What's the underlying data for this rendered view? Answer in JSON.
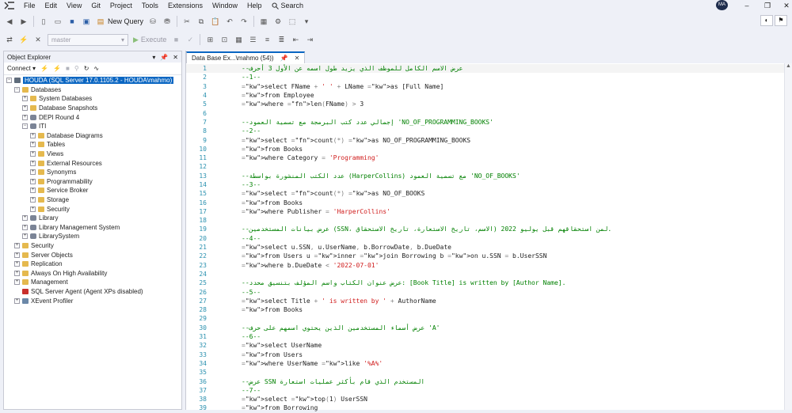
{
  "menubar": {
    "items": [
      "File",
      "Edit",
      "View",
      "Git",
      "Project",
      "Tools",
      "Extensions",
      "Window",
      "Help"
    ],
    "search_label": "Search",
    "avatar_initials": "MA"
  },
  "toolbar": {
    "new_query_label": "New Query",
    "database": "master",
    "execute_label": "Execute"
  },
  "object_explorer": {
    "title": "Object Explorer",
    "connect_label": "Connect",
    "tree": [
      {
        "label": "HOUDA (SQL Server 17.0.1105.2 - HOUDA\\mahmo)",
        "level": 0,
        "expander": "-",
        "icon": "server",
        "selected": true
      },
      {
        "label": "Databases",
        "level": 1,
        "expander": "-",
        "icon": "folder"
      },
      {
        "label": "System Databases",
        "level": 2,
        "expander": "+",
        "icon": "folder"
      },
      {
        "label": "Database Snapshots",
        "level": 2,
        "expander": "+",
        "icon": "folder"
      },
      {
        "label": "DEPI Round 4",
        "level": 2,
        "expander": "+",
        "icon": "db"
      },
      {
        "label": "ITI",
        "level": 2,
        "expander": "-",
        "icon": "db"
      },
      {
        "label": "Database Diagrams",
        "level": 3,
        "expander": "+",
        "icon": "folder"
      },
      {
        "label": "Tables",
        "level": 3,
        "expander": "+",
        "icon": "folder"
      },
      {
        "label": "Views",
        "level": 3,
        "expander": "+",
        "icon": "folder"
      },
      {
        "label": "External Resources",
        "level": 3,
        "expander": "+",
        "icon": "folder"
      },
      {
        "label": "Synonyms",
        "level": 3,
        "expander": "+",
        "icon": "folder"
      },
      {
        "label": "Programmability",
        "level": 3,
        "expander": "+",
        "icon": "folder"
      },
      {
        "label": "Service Broker",
        "level": 3,
        "expander": "+",
        "icon": "folder"
      },
      {
        "label": "Storage",
        "level": 3,
        "expander": "+",
        "icon": "folder"
      },
      {
        "label": "Security",
        "level": 3,
        "expander": "+",
        "icon": "folder"
      },
      {
        "label": "Library",
        "level": 2,
        "expander": "+",
        "icon": "db"
      },
      {
        "label": "Library Management System",
        "level": 2,
        "expander": "+",
        "icon": "db"
      },
      {
        "label": "LibrarySystem",
        "level": 2,
        "expander": "+",
        "icon": "db"
      },
      {
        "label": "Security",
        "level": 1,
        "expander": "+",
        "icon": "folder"
      },
      {
        "label": "Server Objects",
        "level": 1,
        "expander": "+",
        "icon": "folder"
      },
      {
        "label": "Replication",
        "level": 1,
        "expander": "+",
        "icon": "folder"
      },
      {
        "label": "Always On High Availability",
        "level": 1,
        "expander": "+",
        "icon": "folder"
      },
      {
        "label": "Management",
        "level": 1,
        "expander": "+",
        "icon": "folder"
      },
      {
        "label": "SQL Server Agent (Agent XPs disabled)",
        "level": 1,
        "expander": "",
        "icon": "agent"
      },
      {
        "label": "XEvent Profiler",
        "level": 1,
        "expander": "+",
        "icon": "xe"
      }
    ]
  },
  "editor": {
    "tab_title": "Data Base Ex...\\mahmo (54))",
    "lines": [
      {
        "n": "1",
        "kind": "comment",
        "text": "--عرض الاسم الكامل للموظف الذي يزيد طول اسمه عن الأول 3 أحرف"
      },
      {
        "n": "2",
        "kind": "comment",
        "text": "--1--"
      },
      {
        "n": "3",
        "kind": "code",
        "text": "select FName + ' ' + LName as [Full Name]"
      },
      {
        "n": "4",
        "kind": "code",
        "text": "from Employee"
      },
      {
        "n": "5",
        "kind": "code",
        "text": "where len(FName) > 3"
      },
      {
        "n": "6",
        "kind": "blank",
        "text": ""
      },
      {
        "n": "7",
        "kind": "comment",
        "text": "--إجمالي عدد كتب البرمجة مع تسمية العمود 'NO_OF_PROGRAMMING_BOOKS'"
      },
      {
        "n": "8",
        "kind": "comment",
        "text": "--2--"
      },
      {
        "n": "9",
        "kind": "code",
        "text": "select count(*) as NO_OF_PROGRAMMING_BOOKS"
      },
      {
        "n": "10",
        "kind": "code",
        "text": "from Books"
      },
      {
        "n": "11",
        "kind": "code",
        "text": "where Category = 'Programming'"
      },
      {
        "n": "12",
        "kind": "blank",
        "text": ""
      },
      {
        "n": "13",
        "kind": "comment",
        "text": "--عدد الكتب المنشورة بواسطة (HarperCollins) مع تسمية العمود 'NO_OF_BOOKS'"
      },
      {
        "n": "14",
        "kind": "comment",
        "text": "--3--"
      },
      {
        "n": "15",
        "kind": "code",
        "text": "select count(*) as NO_OF_BOOKS"
      },
      {
        "n": "16",
        "kind": "code",
        "text": "from Books"
      },
      {
        "n": "17",
        "kind": "code",
        "text": "where Publisher = 'HarperCollins'"
      },
      {
        "n": "18",
        "kind": "blank",
        "text": ""
      },
      {
        "n": "19",
        "kind": "comment",
        "text": "--عرض بيانات المستخدمين (SSN، الاسم، تاريخ الاستعارة، تاريخ الاستحقاق) لمن استحقاقهم قبل يوليو 2022."
      },
      {
        "n": "20",
        "kind": "comment",
        "text": "--4--"
      },
      {
        "n": "21",
        "kind": "code",
        "text": "select u.SSN, u.UserName, b.BorrowDate, b.DueDate"
      },
      {
        "n": "22",
        "kind": "code",
        "text": "from Users u inner join Borrowing b on u.SSN = b.UserSSN"
      },
      {
        "n": "23",
        "kind": "code",
        "text": "where b.DueDate < '2022-07-01'"
      },
      {
        "n": "24",
        "kind": "blank",
        "text": ""
      },
      {
        "n": "25",
        "kind": "comment",
        "text": "--عرض عنوان الكتاب واسم المؤلف بتنسيق محدد: [Book Title] is written by [Author Name]."
      },
      {
        "n": "26",
        "kind": "comment",
        "text": "--5--"
      },
      {
        "n": "27",
        "kind": "code",
        "text": "select Title + ' is written by ' + AuthorName"
      },
      {
        "n": "28",
        "kind": "code",
        "text": "from Books"
      },
      {
        "n": "29",
        "kind": "blank",
        "text": ""
      },
      {
        "n": "30",
        "kind": "comment",
        "text": "--عرض أسماء المستخدمين الذين يحتوي اسمهم على حرف 'A'"
      },
      {
        "n": "31",
        "kind": "comment",
        "text": "--6--"
      },
      {
        "n": "32",
        "kind": "code",
        "text": "select UserName"
      },
      {
        "n": "33",
        "kind": "code",
        "text": "from Users"
      },
      {
        "n": "34",
        "kind": "code",
        "text": "where UserName like '%A%'"
      },
      {
        "n": "35",
        "kind": "blank",
        "text": ""
      },
      {
        "n": "36",
        "kind": "comment",
        "text": "--عرض SSN المستخدم الذي قام بأكثر عمليات استعارة"
      },
      {
        "n": "37",
        "kind": "comment",
        "text": "--7--"
      },
      {
        "n": "38",
        "kind": "code",
        "text": "select top(1) UserSSN"
      },
      {
        "n": "39",
        "kind": "code",
        "text": "from Borrowing"
      }
    ]
  }
}
